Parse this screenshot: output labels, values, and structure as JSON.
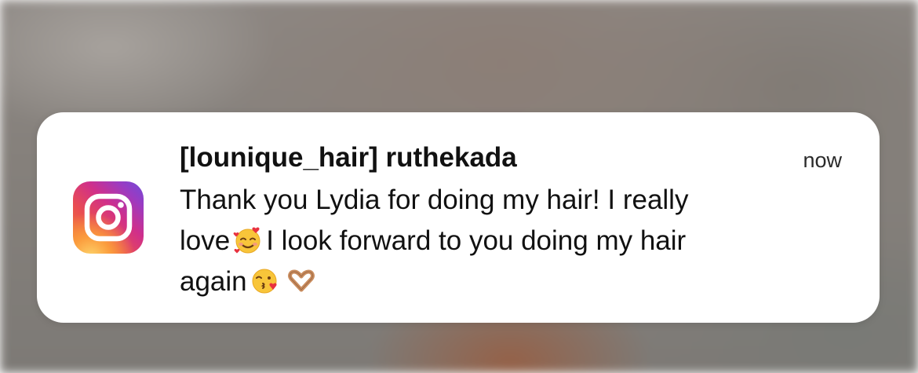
{
  "notification": {
    "app": "Instagram",
    "icon": "instagram-icon",
    "title": "[lounique_hair] ruthekada",
    "time": "now",
    "message_lines": [
      [
        "Thank you Lydia for doing my hair! I really"
      ],
      [
        "love",
        "smiling-face-with-hearts-emoji",
        "I look forward to you doing my hair"
      ],
      [
        "again",
        "face-blowing-kiss-emoji",
        "heart-hands-emoji"
      ]
    ],
    "line1": "Thank you Lydia for doing my hair! I really",
    "line2_a": "love",
    "line2_b": "I look forward to you doing my hair",
    "line3_a": "again"
  },
  "colors": {
    "card": "#ffffff",
    "text": "#111111"
  }
}
